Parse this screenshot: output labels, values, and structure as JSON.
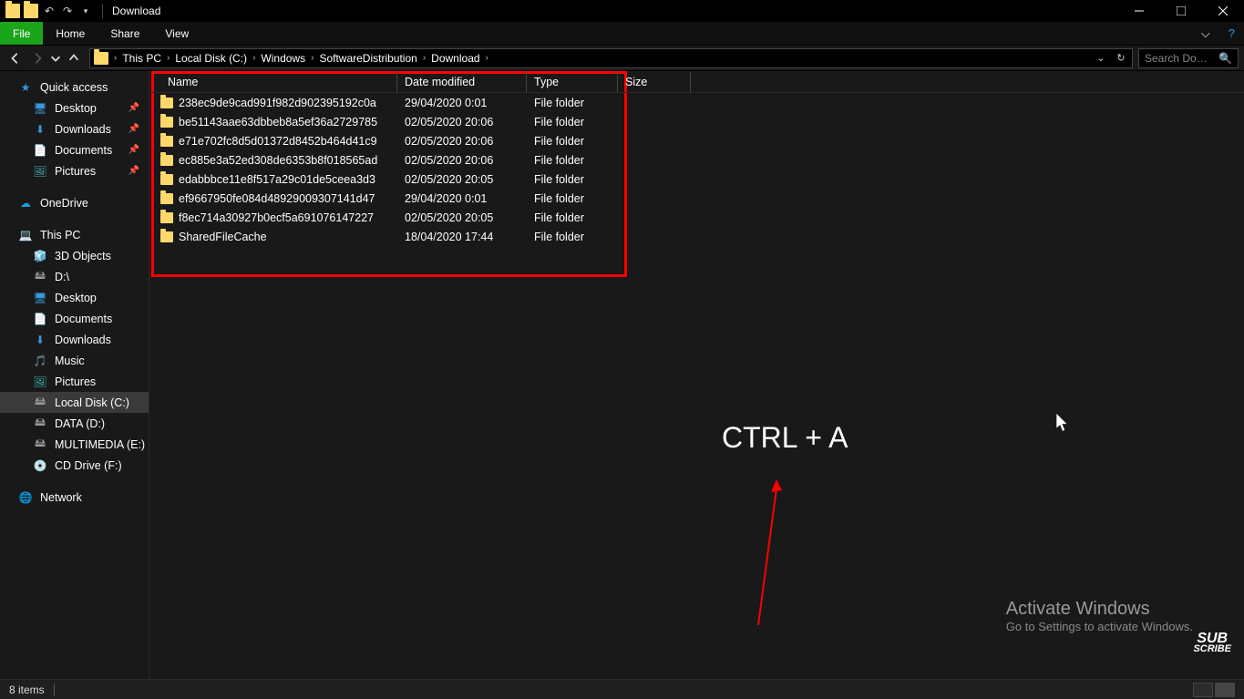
{
  "title": "Download",
  "ribbon": {
    "file": "File",
    "home": "Home",
    "share": "Share",
    "view": "View"
  },
  "breadcrumbs": [
    "This PC",
    "Local Disk (C:)",
    "Windows",
    "SoftwareDistribution",
    "Download"
  ],
  "searchPlaceholder": "Search Do…",
  "columns": {
    "name": "Name",
    "date": "Date modified",
    "type": "Type",
    "size": "Size"
  },
  "files": [
    {
      "name": "238ec9de9cad991f982d902395192c0a",
      "date": "29/04/2020 0:01",
      "type": "File folder"
    },
    {
      "name": "be51143aae63dbbeb8a5ef36a2729785",
      "date": "02/05/2020 20:06",
      "type": "File folder"
    },
    {
      "name": "e71e702fc8d5d01372d8452b464d41c9",
      "date": "02/05/2020 20:06",
      "type": "File folder"
    },
    {
      "name": "ec885e3a52ed308de6353b8f018565ad",
      "date": "02/05/2020 20:06",
      "type": "File folder"
    },
    {
      "name": "edabbbce11e8f517a29c01de5ceea3d3",
      "date": "02/05/2020 20:05",
      "type": "File folder"
    },
    {
      "name": "ef9667950fe084d48929009307141d47",
      "date": "29/04/2020 0:01",
      "type": "File folder"
    },
    {
      "name": "f8ec714a30927b0ecf5a691076147227",
      "date": "02/05/2020 20:05",
      "type": "File folder"
    },
    {
      "name": "SharedFileCache",
      "date": "18/04/2020 17:44",
      "type": "File folder"
    }
  ],
  "sidebar": {
    "quick": "Quick access",
    "quickItems": [
      {
        "label": "Desktop",
        "pin": true,
        "ico": "ic-desktop"
      },
      {
        "label": "Downloads",
        "pin": true,
        "ico": "ic-dl"
      },
      {
        "label": "Documents",
        "pin": true,
        "ico": "ic-doc"
      },
      {
        "label": "Pictures",
        "pin": true,
        "ico": "ic-pic"
      }
    ],
    "onedrive": "OneDrive",
    "thispc": "This PC",
    "pcItems": [
      {
        "label": "3D Objects",
        "ico": "ic-3d"
      },
      {
        "label": "D:\\",
        "ico": "ic-drive"
      },
      {
        "label": "Desktop",
        "ico": "ic-desktop"
      },
      {
        "label": "Documents",
        "ico": "ic-doc"
      },
      {
        "label": "Downloads",
        "ico": "ic-dl"
      },
      {
        "label": "Music",
        "ico": "ic-music"
      },
      {
        "label": "Pictures",
        "ico": "ic-pic"
      },
      {
        "label": "Local Disk (C:)",
        "ico": "ic-drive",
        "sel": true
      },
      {
        "label": "DATA (D:)",
        "ico": "ic-drive"
      },
      {
        "label": "MULTIMEDIA (E:)",
        "ico": "ic-drive"
      },
      {
        "label": "CD Drive (F:)",
        "ico": "ic-cd"
      }
    ],
    "network": "Network"
  },
  "overlay": "CTRL + A",
  "status": "8 items",
  "watermark": {
    "title": "Activate Windows",
    "sub": "Go to Settings to activate Windows."
  },
  "subscribe": {
    "l1": "SUB",
    "l2": "SCRIBE"
  }
}
